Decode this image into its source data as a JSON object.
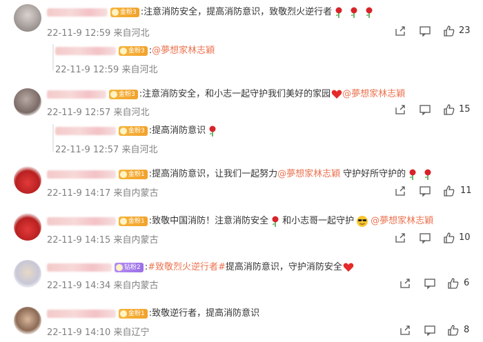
{
  "comments": [
    {
      "badge": "金粉3",
      "text": ":注意消防安全，提高消防意识，致敬烈火逆行者",
      "roses": 3,
      "meta": "22-11-9 12:59 来自河北",
      "likes": "23"
    },
    {
      "badge": "金粉3",
      "mention": "@夢想家林志穎",
      "meta": "22-11-9 12:59 来自河北"
    },
    {
      "badge": "金粉3",
      "text": ":注意消防安全，和小志一起守护我们美好的家园",
      "mention": "@夢想家林志穎",
      "meta": "22-11-9 12:57 来自河北",
      "likes": "15"
    },
    {
      "badge": "金粉3",
      "text": ":提高消防意识",
      "meta": "22-11-9 12:57 来自河北"
    },
    {
      "badge": "金粉1",
      "text": ":提高消防意识，让我们一起努力",
      "mention": "@夢想家林志穎",
      "text2": "守护好所守护的",
      "meta": "22-11-9 14:17 来自内蒙古",
      "likes": "11"
    },
    {
      "badge": "金粉1",
      "text": ":致敬中国消防！注意消防安全",
      "text2": "和小志哥一起守护",
      "mention": "@夢想家林志穎",
      "meta": "22-11-9 14:15 来自内蒙古",
      "likes": "10"
    },
    {
      "badge": "钻粉2",
      "colon": ":",
      "hashtag": "#致敬烈火逆行者#",
      "text": " 提高消防意识，守护消防安全",
      "meta": "22-11-9 14:34 来自内蒙古",
      "likes": "6"
    },
    {
      "badge": "金粉1",
      "text": ":致敬逆行者，提高消防意识",
      "meta": "22-11-9 14:10 来自辽宁",
      "likes": "8"
    }
  ]
}
